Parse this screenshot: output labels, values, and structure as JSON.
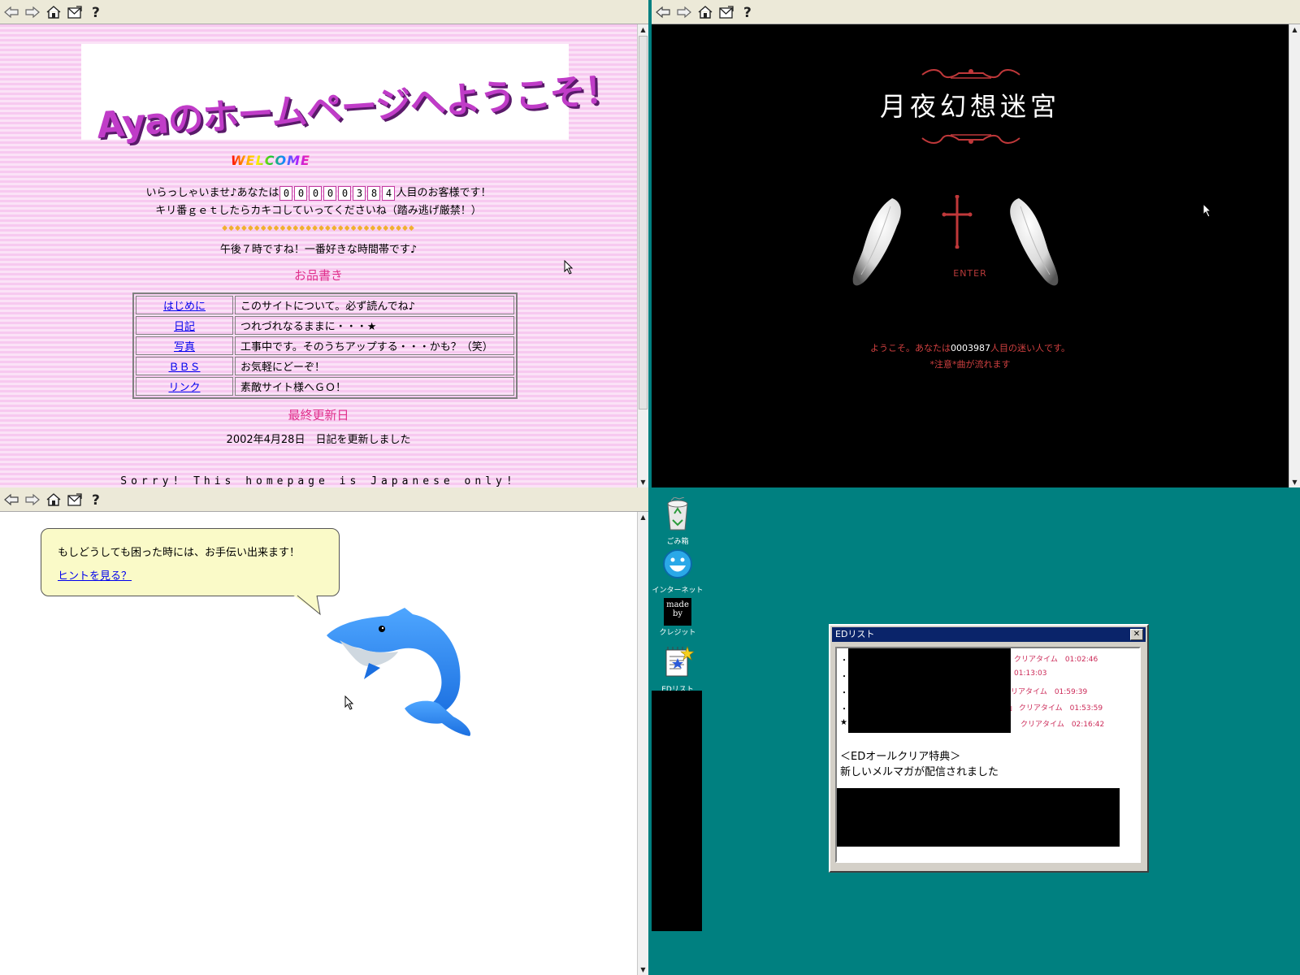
{
  "toolbar": {
    "icons": [
      "back-icon",
      "forward-icon",
      "home-icon",
      "mail-icon",
      "help-icon"
    ]
  },
  "aya": {
    "banner_title": "Ayaのホームページへようこそ！",
    "welcome": "WELCOME",
    "greet_before": "いらっしゃいませ♪あなたは",
    "counter": [
      "0",
      "0",
      "0",
      "0",
      "0",
      "3",
      "8",
      "4"
    ],
    "greet_after": "人目のお客様です！",
    "kiriban": "キリ番ｇｅｔしたらカキコしていってくださいね（踏み逃げ厳禁！）",
    "diamonds": "◆◆◆◆◆◆◆◆◆◆◆◆◆◆◆◆◆◆◆◆◆◆◆◆◆◆◆◆◆◆",
    "time_msg": "午後７時ですね！一番好きな時間帯です♪",
    "menu_heading": "お品書き",
    "menu": [
      {
        "link": "はじめに",
        "desc": "このサイトについて。必ず読んでね♪"
      },
      {
        "link": "日記",
        "desc": "つれづれなるままに・・・★"
      },
      {
        "link": "写真",
        "desc": "工事中です。そのうちアップする・・・かも？（笑）"
      },
      {
        "link": "ＢＢＳ",
        "desc": "お気軽にどーぞ！"
      },
      {
        "link": "リンク",
        "desc": "素敵サイト様へＧＯ！"
      }
    ],
    "updated_heading": "最終更新日",
    "updated_text": "2002年4月28日　日記を更新しました",
    "sorry": "Sorry! This homepage is Japanese only!",
    "colors": {
      "pink": "#e0308c",
      "stripe": "#f7c9f0"
    }
  },
  "tsukiyo": {
    "title": "月夜幻想迷宮",
    "enter": "ENTER",
    "visitor_before": "ようこそ。あなたは",
    "visitor_count": "0003987",
    "visitor_after": "人目の迷い人です。",
    "notice": "*注意*曲が流れます",
    "colors": {
      "accent": "#c0383a"
    }
  },
  "dolphin": {
    "bubble_text": "もしどうしても困った時には、お手伝い出来ます！",
    "hint_link": "ヒントを見る？"
  },
  "desktop": {
    "icons": [
      {
        "name": "recycle-bin-icon",
        "label": "ごみ箱"
      },
      {
        "name": "internet-icon",
        "label": "インターネット"
      },
      {
        "name": "credits-icon",
        "label": "クレジット",
        "glyph": "made by"
      },
      {
        "name": "ed-list-icon",
        "label": "EDリスト"
      }
    ],
    "window": {
      "title": "EDリスト",
      "close": "✕",
      "rows": [
        {
          "bullet": "・",
          "text": "クリアタイム　01:02:46"
        },
        {
          "bullet": "・",
          "text": "01:13:03"
        },
        {
          "bullet": "・",
          "text": "リアタイム　01:59:39"
        },
        {
          "bullet": "・",
          "text": "」 クリアタイム　01:53:59"
        },
        {
          "bullet": "★",
          "text": "クリアタイム　02:16:42"
        }
      ],
      "bonus_heading": "＜EDオールクリア特典＞",
      "bonus_text": "新しいメルマガが配信されました"
    }
  }
}
